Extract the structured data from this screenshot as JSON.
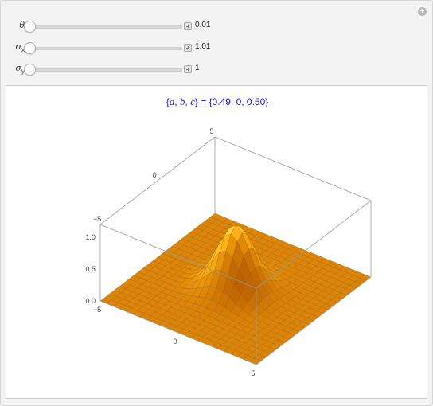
{
  "controls": [
    {
      "symbol": "θ",
      "subscript": "",
      "value": "0.01",
      "fraction": 0.0
    },
    {
      "symbol": "σ",
      "subscript": "x",
      "value": "1.01",
      "fraction": 0.0
    },
    {
      "symbol": "σ",
      "subscript": "y",
      "value": "1",
      "fraction": 0.0
    }
  ],
  "title": {
    "vars_open": "{",
    "var_a": "a",
    "sep1": ", ",
    "var_b": "b",
    "sep2": ", ",
    "var_c": "c",
    "rest": "} = {0.49, 0, 0.50}"
  },
  "plot": {
    "type": "surface3d",
    "function": "exp(-(a x^2 + 2 b x y + c y^2))",
    "x_ticks": [
      "−5",
      "0",
      "5"
    ],
    "y_ticks": [
      "5",
      "0",
      "−5"
    ],
    "z_ticks": [
      "1.0",
      "0.5",
      "0.0"
    ],
    "x_range": [
      -5,
      5
    ],
    "y_range": [
      -5,
      5
    ],
    "z_range": [
      0,
      1
    ],
    "colors": {
      "surface_low": "#ff9a00",
      "surface_high": "#ffe75a",
      "mesh": "#7a4a00",
      "title": "#1a1aee"
    }
  }
}
